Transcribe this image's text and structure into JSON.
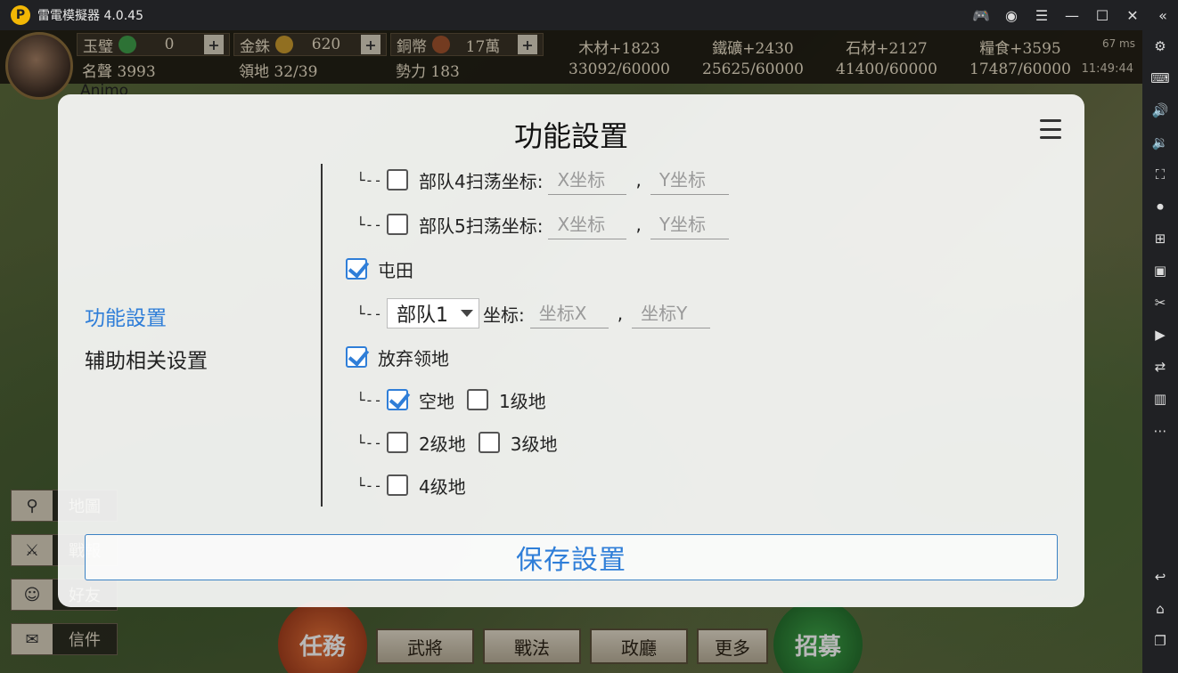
{
  "window": {
    "title": "雷電模擬器 4.0.45",
    "logo": "P"
  },
  "hud": {
    "currencies": [
      {
        "name": "玉璧",
        "value": "0",
        "color": "#3f9e4a"
      },
      {
        "name": "金銖",
        "value": "620",
        "color": "#c99a2e"
      },
      {
        "name": "銅幣",
        "value": "17萬",
        "color": "#a0522d"
      }
    ],
    "stats": [
      {
        "label": "名聲",
        "value": "3993"
      },
      {
        "label": "領地",
        "value": "32/39"
      },
      {
        "label": "勢力",
        "value": "183"
      }
    ],
    "resources": [
      {
        "top": "木材+1823",
        "bottom": "33092/60000"
      },
      {
        "top": "鐵礦+2430",
        "bottom": "25625/60000"
      },
      {
        "top": "石材+2127",
        "bottom": "41400/60000"
      },
      {
        "top": "糧食+3595",
        "bottom": "17487/60000"
      }
    ],
    "ping": "67 ms",
    "clock": "11:49:44",
    "player_name": "Animo"
  },
  "game": {
    "left_buttons": [
      "地圖",
      "戰報",
      "好友",
      "信件"
    ],
    "round_left": "任務",
    "round_right": "招募",
    "bottom_buttons": [
      "武將",
      "戰法",
      "政廳",
      "更多"
    ]
  },
  "dialog": {
    "title": "功能設置",
    "nav": [
      "功能設置",
      "辅助相关设置"
    ],
    "tree_glyph": "└--",
    "rows": {
      "troop4_label": "部队4扫荡坐标:",
      "troop5_label": "部队5扫荡坐标:",
      "x_placeholder": "X坐标",
      "y_placeholder": "Y坐标",
      "comma": ",",
      "tuntian_label": "屯田",
      "troop_select": "部队1",
      "coord_label": "坐标:",
      "coordx_placeholder": "坐标X",
      "coordy_placeholder": "坐标Y",
      "abandon_label": "放弃领地",
      "empty_label": "空地",
      "lv1_label": "1级地",
      "lv2_label": "2级地",
      "lv3_label": "3级地",
      "lv4_label": "4级地"
    },
    "save_label": "保存設置"
  },
  "colors": {
    "accent": "#2f7ed8"
  }
}
